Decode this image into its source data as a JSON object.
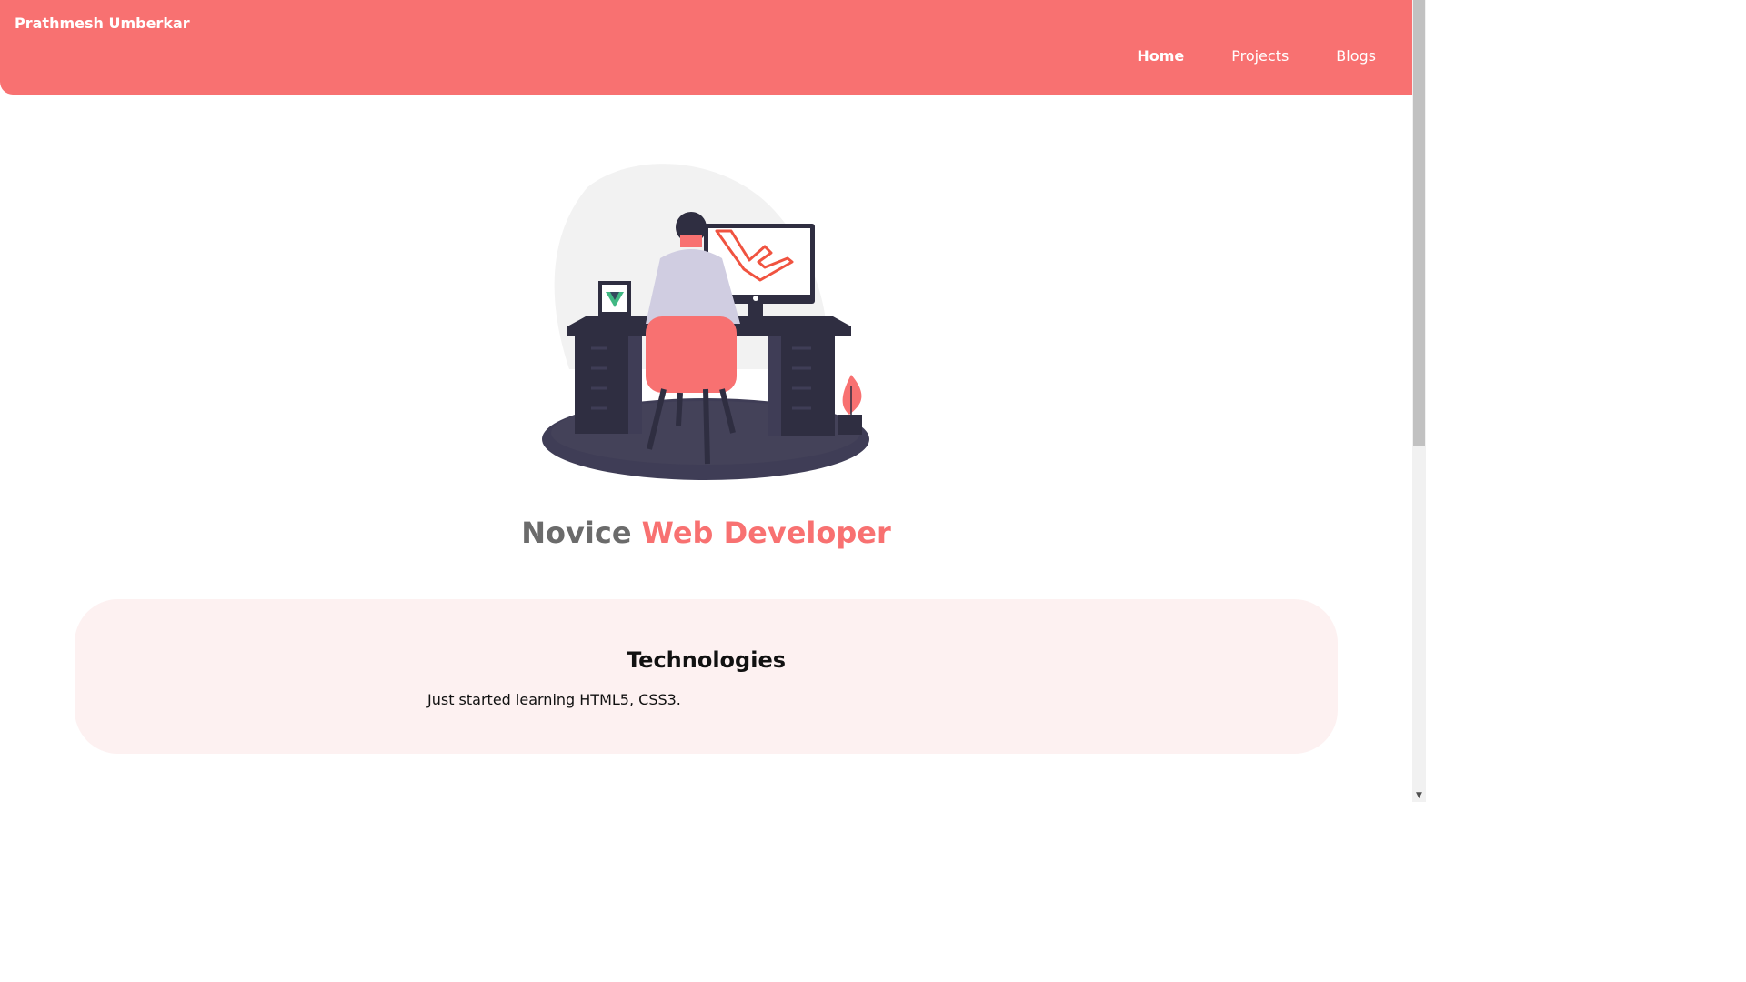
{
  "header": {
    "brand": "Prathmesh Umberkar",
    "nav": [
      {
        "label": "Home",
        "active": true
      },
      {
        "label": "Projects",
        "active": false
      },
      {
        "label": "Blogs",
        "active": false
      }
    ]
  },
  "hero": {
    "illustration": "developer-at-desk-illustration",
    "tagline_part1": "Novice",
    "tagline_part2": "Web Developer"
  },
  "technologies": {
    "title": "Technologies",
    "text": "Just started learning HTML5, CSS3."
  },
  "colors": {
    "accent": "#f87171",
    "card_background": "#fdf1f1",
    "muted_text": "#6b6b6b"
  }
}
